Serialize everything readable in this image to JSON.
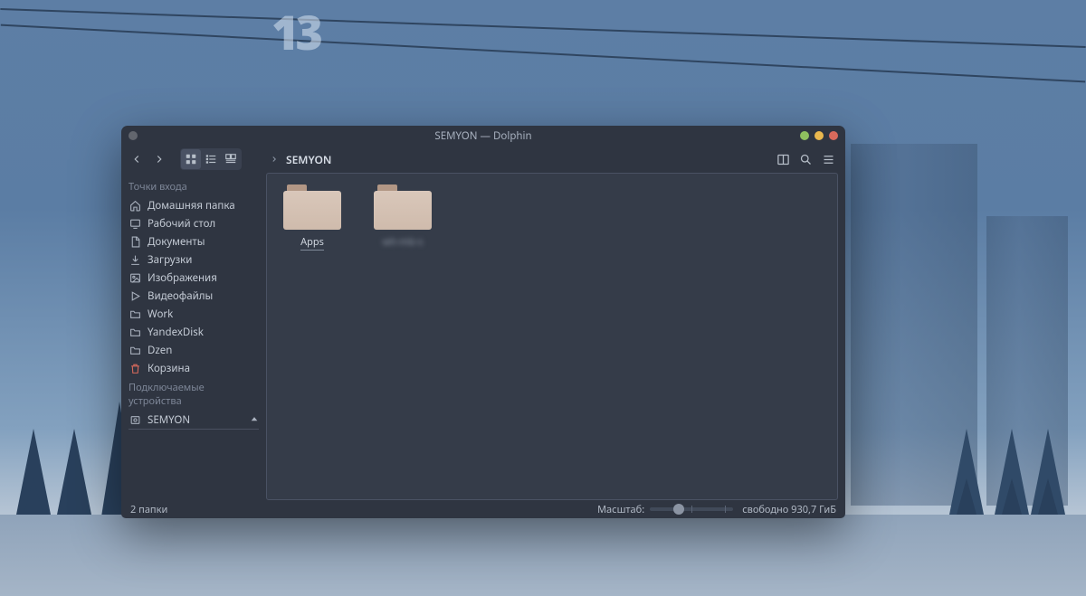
{
  "desktop": {
    "badge": "13"
  },
  "window": {
    "title": "SEMYON — Dolphin",
    "breadcrumb": {
      "current": "SEMYON"
    }
  },
  "sidebar": {
    "section_places": "Точки входа",
    "section_devices": "Подключаемые устройства",
    "places": [
      {
        "icon": "home",
        "label": "Домашняя папка"
      },
      {
        "icon": "desktop",
        "label": "Рабочий стол"
      },
      {
        "icon": "document",
        "label": "Документы"
      },
      {
        "icon": "download",
        "label": "Загрузки"
      },
      {
        "icon": "image",
        "label": "Изображения"
      },
      {
        "icon": "video",
        "label": "Видеофайлы"
      },
      {
        "icon": "folder",
        "label": "Work"
      },
      {
        "icon": "folder",
        "label": "YandexDisk"
      },
      {
        "icon": "folder",
        "label": "Dzen"
      },
      {
        "icon": "trash",
        "label": "Корзина"
      }
    ],
    "devices": [
      {
        "icon": "disk",
        "label": "SEMYON"
      }
    ]
  },
  "content": {
    "folders": [
      {
        "label": "Apps",
        "selected": true,
        "obscured": false
      },
      {
        "label": "wh-mb-s",
        "selected": false,
        "obscured": true
      }
    ]
  },
  "statusbar": {
    "item_count": "2 папки",
    "zoom_label": "Масштаб:",
    "free_space": "свободно 930,7 ГиБ"
  }
}
